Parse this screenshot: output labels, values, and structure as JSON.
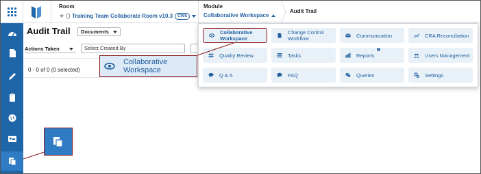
{
  "header": {
    "room_label": "Room",
    "room_name": "Training Team Collaborate Room v10.3",
    "room_badge": "CWS",
    "module_label": "Module",
    "module_name": "Collaborative Workspace",
    "breadcrumb": "Audit Trail"
  },
  "page": {
    "title": "Audit Trail",
    "documents_select": "Documents",
    "actions_filter": "Actions Taken",
    "created_by_placeholder": "Select Created By",
    "selection_count": "0 - 0 of 0 (0 selected)"
  },
  "modules": [
    {
      "label": "Collaborative Workspace",
      "icon": "eye-icon",
      "selected": true
    },
    {
      "label": "Change Control Workflow",
      "icon": "document-icon",
      "selected": false
    },
    {
      "label": "Communication",
      "icon": "envelope-icon",
      "selected": false
    },
    {
      "label": "CRA Reconciliation",
      "icon": "chart-icon",
      "selected": false
    },
    {
      "label": "Quality Review",
      "icon": "hash-icon",
      "selected": false
    },
    {
      "label": "Tasks",
      "icon": "list-icon",
      "selected": false
    },
    {
      "label": "Reports",
      "icon": "bar-chart-icon",
      "selected": false
    },
    {
      "label": "Users Management",
      "icon": "users-icon",
      "selected": false
    },
    {
      "label": "Q & A",
      "icon": "chat-icon",
      "selected": false
    },
    {
      "label": "FAQ",
      "icon": "speech-icon",
      "selected": false
    },
    {
      "label": "Queries",
      "icon": "comments-icon",
      "selected": false
    },
    {
      "label": "Settings",
      "icon": "gears-icon",
      "selected": false
    }
  ],
  "callouts": {
    "module_zoom_label": "Collaborative Workspace"
  },
  "colors": {
    "sidebar": "#1f66a8",
    "accent": "#1f5f9e",
    "tile_bg": "#e8f0f8",
    "callout_border": "#8b1a1a"
  }
}
